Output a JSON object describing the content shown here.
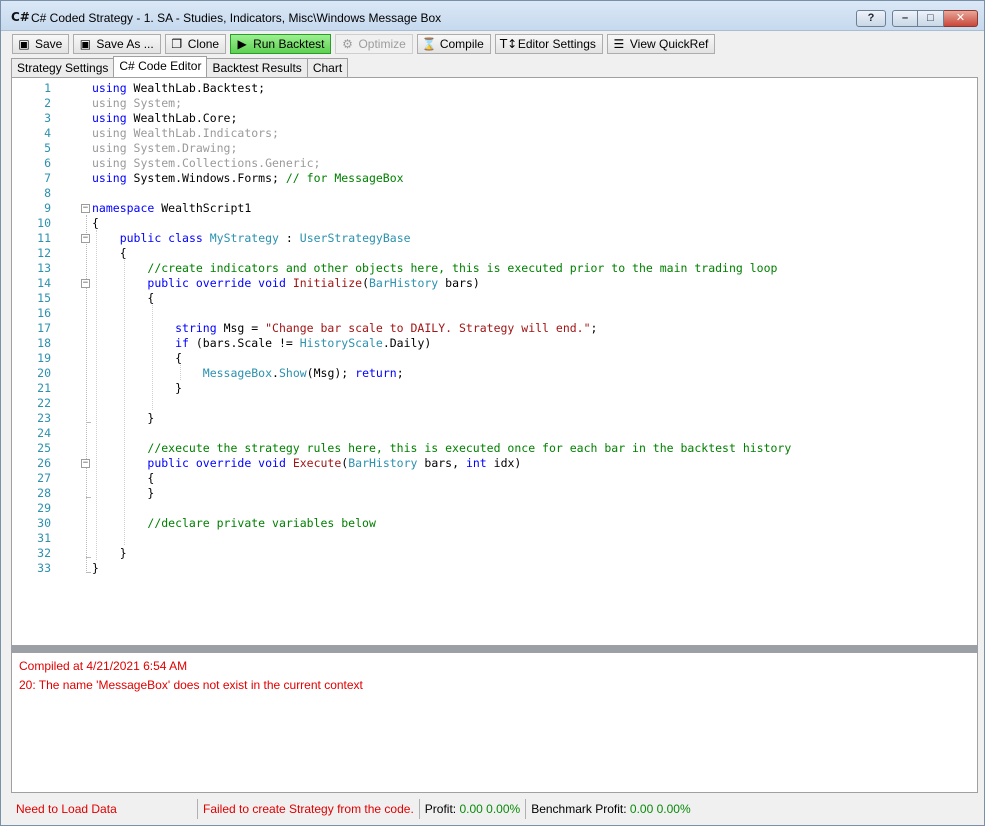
{
  "window": {
    "icon_text": "C#",
    "title": "C# Coded Strategy - 1. SA - Studies, Indicators, Misc\\Windows Message Box",
    "help_label": "?",
    "min_label": "–",
    "max_label": "□",
    "close_label": "✕"
  },
  "toolbar": {
    "save": "Save",
    "save_as": "Save As ...",
    "clone": "Clone",
    "run_backtest": "Run Backtest",
    "optimize": "Optimize",
    "compile": "Compile",
    "editor_settings": "Editor Settings",
    "view_quickref": "View QuickRef"
  },
  "tabs": [
    "Strategy Settings",
    "C# Code Editor",
    "Backtest Results",
    "Chart"
  ],
  "editor": {
    "line_numbers": [
      "1",
      "2",
      "3",
      "4",
      "5",
      "6",
      "7",
      "8",
      "9",
      "10",
      "11",
      "12",
      "13",
      "14",
      "15",
      "16",
      "17",
      "18",
      "19",
      "20",
      "21",
      "22",
      "23",
      "24",
      "25",
      "26",
      "27",
      "28",
      "29",
      "30",
      "31",
      "32",
      "33"
    ]
  },
  "output": {
    "line1": "Compiled at 4/21/2021 6:54 AM",
    "line2": "20: The name 'MessageBox' does not exist in the current context"
  },
  "status": {
    "data_status": "Need to Load Data",
    "strategy_status": "Failed to create Strategy from the code.",
    "profit_label": "Profit:",
    "profit_value": "0.00",
    "profit_pct": "0.00%",
    "benchmark_label": "Benchmark Profit:",
    "benchmark_value": "0.00",
    "benchmark_pct": "0.00%"
  },
  "colors": {
    "keyword": "#0000ff",
    "type": "#2b91af",
    "comment": "#008000",
    "string": "#a31515",
    "error": "#e00000",
    "run_button": "#5ed052"
  }
}
